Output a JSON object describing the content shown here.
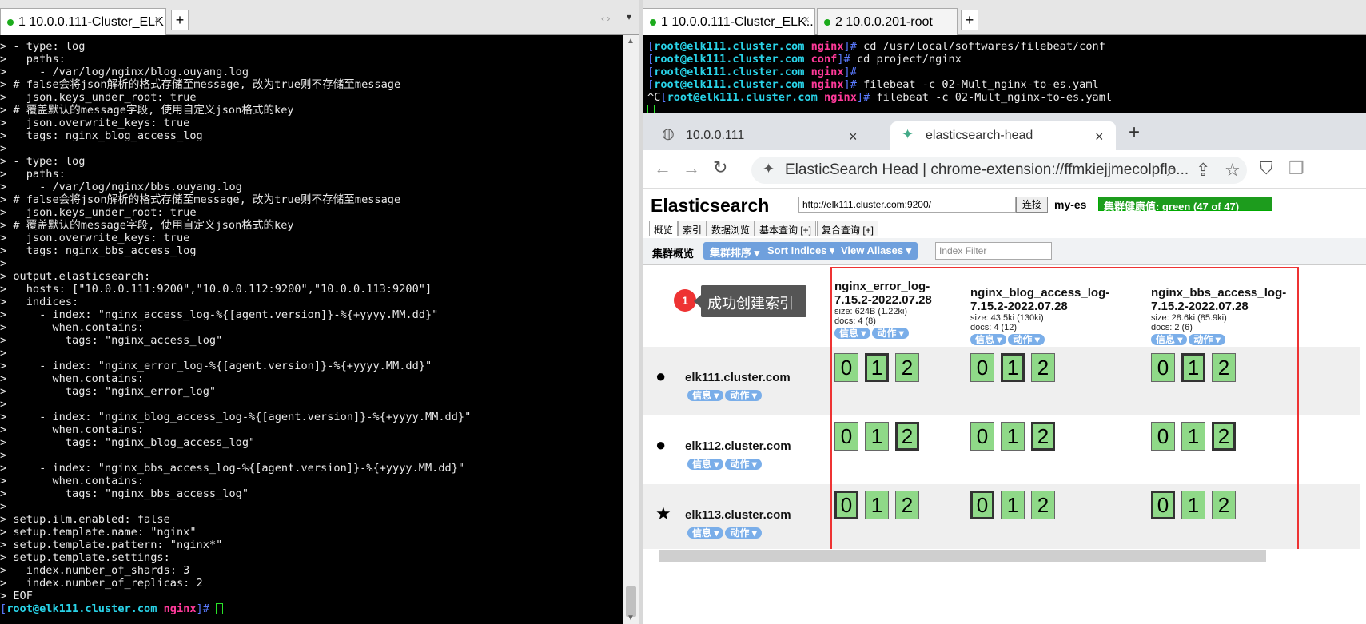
{
  "left_terminal": {
    "tab_label": "1 10.0.0.111-Cluster_ELK...",
    "tab_close": "×",
    "new_tab": "+",
    "nav_arrows": "‹ ›",
    "menu_arrow": "▾",
    "lines": [
      "> - type: log",
      ">   paths:",
      ">     - /var/log/nginx/blog.ouyang.log",
      "> # false会将json解析的格式存储至message, 改为true则不存储至message",
      ">   json.keys_under_root: true",
      "> # 覆盖默认的message字段, 使用自定义json格式的key",
      ">   json.overwrite_keys: true",
      ">   tags: nginx_blog_access_log",
      ">",
      "> - type: log",
      ">   paths:",
      ">     - /var/log/nginx/bbs.ouyang.log",
      "> # false会将json解析的格式存储至message, 改为true则不存储至message",
      ">   json.keys_under_root: true",
      "> # 覆盖默认的message字段, 使用自定义json格式的key",
      ">   json.overwrite_keys: true",
      ">   tags: nginx_bbs_access_log",
      ">",
      "> output.elasticsearch:",
      ">   hosts: [\"10.0.0.111:9200\",\"10.0.0.112:9200\",\"10.0.0.113:9200\"]",
      ">   indices:",
      ">     - index: \"nginx_access_log-%{[agent.version]}-%{+yyyy.MM.dd}\"",
      ">       when.contains:",
      ">         tags: \"nginx_access_log\"",
      ">",
      ">     - index: \"nginx_error_log-%{[agent.version]}-%{+yyyy.MM.dd}\"",
      ">       when.contains:",
      ">         tags: \"nginx_error_log\"",
      ">",
      ">     - index: \"nginx_blog_access_log-%{[agent.version]}-%{+yyyy.MM.dd}\"",
      ">       when.contains:",
      ">         tags: \"nginx_blog_access_log\"",
      ">",
      ">     - index: \"nginx_bbs_access_log-%{[agent.version]}-%{+yyyy.MM.dd}\"",
      ">       when.contains:",
      ">         tags: \"nginx_bbs_access_log\"",
      ">",
      "> setup.ilm.enabled: false",
      "> setup.template.name: \"nginx\"",
      "> setup.template.pattern: \"nginx*\"",
      "> setup.template.settings:",
      ">   index.number_of_shards: 3",
      ">   index.number_of_replicas: 2",
      "> EOF"
    ],
    "prompt": {
      "open": "[",
      "user": "root@elk111.cluster.com",
      "dir": "nginx",
      "close": "]#"
    }
  },
  "right_terminal": {
    "tabs": [
      {
        "label": "1 10.0.0.111-Cluster_ELK...",
        "close": "×"
      },
      {
        "label": "2 10.0.0.201-root",
        "close": ""
      }
    ],
    "new_tab": "+",
    "lines": [
      {
        "pre": "",
        "user": "root@elk111.cluster.com",
        "dir": "nginx",
        "cmd": "cd /usr/local/softwares/filebeat/conf"
      },
      {
        "pre": "",
        "user": "root@elk111.cluster.com",
        "dir": "conf",
        "cmd": "cd project/nginx"
      },
      {
        "pre": "",
        "user": "root@elk111.cluster.com",
        "dir": "nginx",
        "cmd": ""
      },
      {
        "pre": "",
        "user": "root@elk111.cluster.com",
        "dir": "nginx",
        "cmd": "filebeat -c 02-Mult_nginx-to-es.yaml"
      },
      {
        "pre": "^C",
        "user": "root@elk111.cluster.com",
        "dir": "nginx",
        "cmd": "filebeat -c 02-Mult_nginx-to-es.yaml"
      }
    ]
  },
  "browser": {
    "tabs": [
      {
        "label": "10.0.0.111",
        "close": "×"
      },
      {
        "label": "elasticsearch-head",
        "close": "×"
      }
    ],
    "new_tab": "+",
    "omnibox": "ElasticSearch Head  |  chrome-extension://ffmkiejjmecolpflo...",
    "icons": {
      "back": "←",
      "forward": "→",
      "reload": "↻",
      "extension": "✦",
      "zoom": "⌕",
      "share": "⇪",
      "star": "☆",
      "shield": "⛉",
      "copy": "❐",
      "globe": "◍",
      "puzzle": "✦"
    }
  },
  "es_head": {
    "title": "Elasticsearch",
    "url": "http://elk111.cluster.com:9200/",
    "connect": "连接",
    "cluster_name": "my-es",
    "health": "集群健康值: green (47 of 47)",
    "health_color": "#1d9c1d",
    "subtabs": [
      "概览",
      "索引",
      "数据浏览",
      "基本查询 [+]",
      "复合查询 [+]"
    ],
    "overview_label": "集群概览",
    "toolbar_buttons": [
      "集群排序 ▾",
      "Sort Indices ▾",
      "View Aliases ▾"
    ],
    "filter_placeholder": "Index Filter",
    "callout_number": "1",
    "callout_text": "成功创建索引",
    "indices": [
      {
        "name": "nginx_error_log-7.15.2-2022.07.28",
        "size": "size: 624B (1.22ki)",
        "docs": "docs: 4 (8)"
      },
      {
        "name": "nginx_blog_access_log-7.15.2-2022.07.28",
        "size": "size: 43.5ki (130ki)",
        "docs": "docs: 4 (12)"
      },
      {
        "name": "nginx_bbs_access_log-7.15.2-2022.07.28",
        "size": "size: 28.6ki (85.9ki)",
        "docs": "docs: 2 (6)"
      }
    ],
    "info_label": "信息 ▾",
    "action_label": "动作 ▾",
    "nodes": [
      {
        "symbol": "●",
        "name": "elk111.cluster.com"
      },
      {
        "symbol": "●",
        "name": "elk112.cluster.com"
      },
      {
        "symbol": "★",
        "name": "elk113.cluster.com"
      }
    ],
    "shard_labels": [
      "0",
      "1",
      "2"
    ],
    "primary_map": [
      [
        [
          0,
          1,
          0
        ],
        [
          0,
          1,
          0
        ],
        [
          0,
          1,
          0
        ]
      ],
      [
        [
          0,
          0,
          1
        ],
        [
          0,
          0,
          1
        ],
        [
          0,
          0,
          1
        ]
      ],
      [
        [
          1,
          0,
          0
        ],
        [
          1,
          0,
          0
        ],
        [
          1,
          0,
          0
        ]
      ]
    ],
    "shard_color": "#8fd988",
    "highlight_color": "#e33"
  }
}
